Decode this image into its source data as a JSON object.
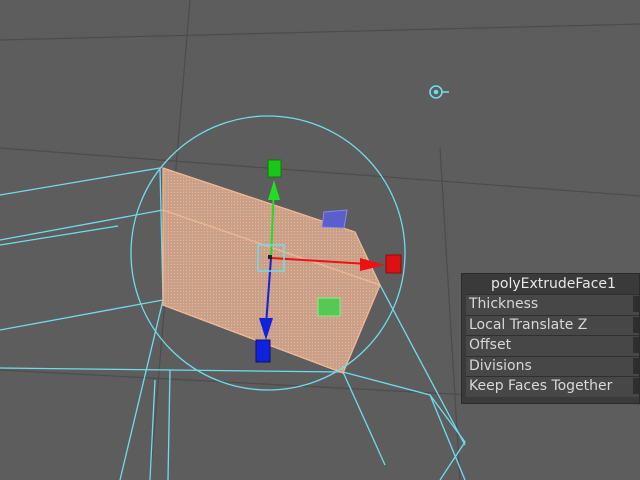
{
  "viewport": {
    "colors": {
      "background": "#5d5d5d",
      "grid": "#4a4a4a",
      "wireframe": "#6fdcec",
      "selected_face_fill": "#d9a98a",
      "selected_face_edge": "#f0b896",
      "gizmo_y": "#22dd22",
      "gizmo_x": "#ee1111",
      "gizmo_z": "#1122dd"
    },
    "icons": {
      "camera_target": "crosshair-circle-icon",
      "manipulator": "move-rotate-manipulator-icon"
    }
  },
  "hud": {
    "title": "polyExtrudeFace1",
    "rows": [
      {
        "label": "Thickness"
      },
      {
        "label": "Local Translate Z"
      },
      {
        "label": "Offset"
      },
      {
        "label": "Divisions"
      },
      {
        "label": "Keep Faces Together"
      }
    ]
  }
}
